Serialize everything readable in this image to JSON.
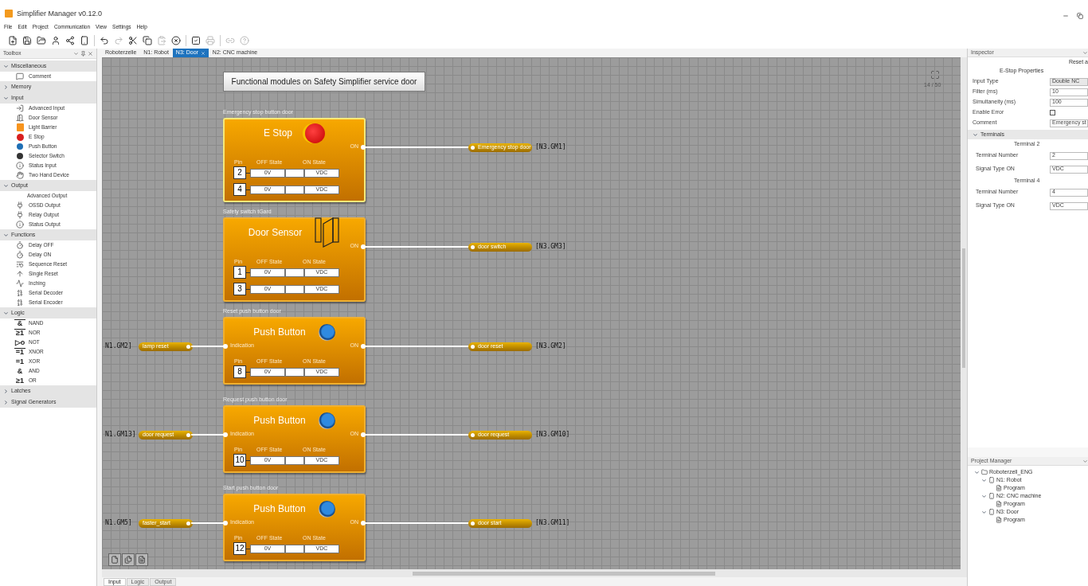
{
  "window": {
    "title": "Simplifier Manager v0.12.0"
  },
  "menu": [
    "File",
    "Edit",
    "Project",
    "Communication",
    "View",
    "Settings",
    "Help"
  ],
  "toolbox": {
    "title": "Toolbox",
    "sections": [
      {
        "label": "Miscellaneous",
        "expanded": true,
        "items": [
          {
            "label": "Comment",
            "kind": "icon"
          }
        ]
      },
      {
        "label": "Memory",
        "expanded": false
      },
      {
        "label": "Input",
        "expanded": true,
        "items": [
          {
            "label": "Advanced Input",
            "kind": "icon"
          },
          {
            "label": "Door Sensor",
            "kind": "icon"
          },
          {
            "label": "Light Barrier",
            "kind": "icon"
          },
          {
            "label": "E Stop",
            "kind": "icon"
          },
          {
            "label": "Push Button",
            "kind": "icon"
          },
          {
            "label": "Selector Switch",
            "kind": "icon"
          },
          {
            "label": "Status Input",
            "kind": "icon"
          },
          {
            "label": "Two Hand Device",
            "kind": "icon"
          }
        ]
      },
      {
        "label": "Output",
        "expanded": true,
        "items": [
          {
            "label": "Advanced Output",
            "kind": "plain"
          },
          {
            "label": "OSSD Output",
            "kind": "icon"
          },
          {
            "label": "Relay Output",
            "kind": "icon"
          },
          {
            "label": "Status Output",
            "kind": "icon"
          }
        ]
      },
      {
        "label": "Functions",
        "expanded": true,
        "items": [
          {
            "label": "Delay OFF",
            "kind": "icon"
          },
          {
            "label": "Delay ON",
            "kind": "icon"
          },
          {
            "label": "Sequence Reset",
            "kind": "icon"
          },
          {
            "label": "Single Reset",
            "kind": "icon"
          },
          {
            "label": "Inching",
            "kind": "icon"
          },
          {
            "label": "Serial Decoder",
            "kind": "icon"
          },
          {
            "label": "Serial Encoder",
            "kind": "icon"
          }
        ]
      },
      {
        "label": "Logic",
        "expanded": true,
        "items": [
          {
            "label": "NAND",
            "kind": "symbol",
            "symbol": "&",
            "overline": true
          },
          {
            "label": "NOR",
            "kind": "symbol",
            "symbol": "≥1",
            "overline": true
          },
          {
            "label": "NOT",
            "kind": "symbol",
            "symbol": "▷o",
            "overline": false
          },
          {
            "label": "XNOR",
            "kind": "symbol",
            "symbol": "=1",
            "overline": true
          },
          {
            "label": "XOR",
            "kind": "symbol",
            "symbol": "=1",
            "overline": false
          },
          {
            "label": "AND",
            "kind": "symbol",
            "symbol": "&",
            "overline": false
          },
          {
            "label": "OR",
            "kind": "symbol",
            "symbol": "≥1",
            "overline": false
          }
        ]
      },
      {
        "label": "Latches",
        "expanded": false
      },
      {
        "label": "Signal Generators",
        "expanded": false
      }
    ]
  },
  "tabs": [
    {
      "label": "Roboterzelle",
      "selected": false
    },
    {
      "label": "N1: Robot",
      "selected": false
    },
    {
      "label": "N3: Door",
      "selected": true
    },
    {
      "label": "N2: CNC machine",
      "selected": false
    }
  ],
  "canvas": {
    "title": "Functional modules on Safety Simplifier service door",
    "zoom": "14 / 50",
    "modules": [
      {
        "caption": "Emergency stop button door",
        "title": "E Stop",
        "kind": "estop",
        "selected": true,
        "on_label": "ON",
        "pin_header": [
          "Pin",
          "OFF State",
          "ON State"
        ],
        "pins": [
          {
            "number": "2",
            "off": "0V",
            "on": "VDC"
          },
          {
            "number": "4",
            "off": "0V",
            "on": "VDC"
          }
        ],
        "output": {
          "signal": "Emergency stop door",
          "ref": "[N3.GM1]"
        }
      },
      {
        "caption": "Safety switch tGard",
        "title": "Door Sensor",
        "kind": "door",
        "selected": false,
        "on_label": "ON",
        "pin_header": [
          "Pin",
          "OFF State",
          "ON State"
        ],
        "pins": [
          {
            "number": "1",
            "off": "0V",
            "on": "VDC"
          },
          {
            "number": "3",
            "off": "0V",
            "on": "VDC"
          }
        ],
        "output": {
          "signal": "door switch",
          "ref": "[N3.GM3]"
        }
      },
      {
        "caption": "Reset push button door",
        "title": "Push Button",
        "kind": "pushbutton",
        "selected": false,
        "on_label": "ON",
        "pin_header": [
          "Pin",
          "OFF State",
          "ON State"
        ],
        "pins": [
          {
            "number": "8",
            "off": "0V",
            "on": "VDC"
          }
        ],
        "input": {
          "label": "Indication",
          "signal": "lamp reset",
          "ref": "N1.GM2]"
        },
        "output": {
          "signal": "door reset",
          "ref": "[N3.GM2]"
        }
      },
      {
        "caption": "Request push button door",
        "title": "Push Button",
        "kind": "pushbutton",
        "selected": false,
        "on_label": "ON",
        "pin_header": [
          "Pin",
          "OFF State",
          "ON State"
        ],
        "pins": [
          {
            "number": "10",
            "off": "0V",
            "on": "VDC"
          }
        ],
        "input": {
          "label": "Indication",
          "signal": "door request",
          "ref": "N1.GM13]"
        },
        "output": {
          "signal": "door request",
          "ref": "[N3.GM10]"
        }
      },
      {
        "caption": "Start push button door",
        "title": "Push Button",
        "kind": "pushbutton",
        "selected": false,
        "on_label": "ON",
        "pin_header": [
          "Pin",
          "OFF State",
          "ON State"
        ],
        "pins": [
          {
            "number": "12",
            "off": "0V",
            "on": "VDC"
          }
        ],
        "input": {
          "label": "Indication",
          "signal": "faster_start",
          "ref": "N1.GM5]"
        },
        "output": {
          "signal": "door start",
          "ref": "[N3.GM11]"
        }
      }
    ]
  },
  "bottom_tabs": [
    {
      "label": "Input",
      "selected": true
    },
    {
      "label": "Logic",
      "selected": false
    },
    {
      "label": "Output",
      "selected": false
    }
  ],
  "inspector": {
    "title": "Inspector",
    "reset": "Reset a",
    "heading": "E-Stop Properties",
    "properties": [
      {
        "label": "Input Type",
        "kind": "select",
        "value": "Double NC"
      },
      {
        "label": "Filter (ms)",
        "kind": "input",
        "value": "10"
      },
      {
        "label": "Simultaneity (ms)",
        "kind": "input",
        "value": "100"
      },
      {
        "label": "Enable Error",
        "kind": "checkbox",
        "checked": false
      },
      {
        "label": "Comment",
        "kind": "input",
        "value": "Emergency st"
      }
    ],
    "terminals": {
      "label": "Terminals",
      "expanded": true,
      "groups": [
        {
          "title": "Terminal 2",
          "rows": [
            {
              "label": "Terminal Number",
              "value": "2"
            },
            {
              "label": "Signal Type ON",
              "value": "VDC"
            }
          ]
        },
        {
          "title": "Terminal 4",
          "rows": [
            {
              "label": "Terminal Number",
              "value": "4"
            },
            {
              "label": "Signal Type ON",
              "value": "VDC"
            }
          ]
        }
      ]
    }
  },
  "project_manager": {
    "title": "Project Manager",
    "tree": [
      {
        "label": "Roboterzell_ENG",
        "kind": "project",
        "expanded": true,
        "children": [
          {
            "label": "N1: Robot",
            "kind": "node",
            "expanded": true,
            "children": [
              {
                "label": "Program",
                "kind": "program"
              }
            ]
          },
          {
            "label": "N2: CNC machine",
            "kind": "node",
            "expanded": true,
            "children": [
              {
                "label": "Program",
                "kind": "program"
              }
            ]
          },
          {
            "label": "N3: Door",
            "kind": "node",
            "expanded": true,
            "children": [
              {
                "label": "Program",
                "kind": "program"
              }
            ]
          }
        ]
      }
    ]
  }
}
